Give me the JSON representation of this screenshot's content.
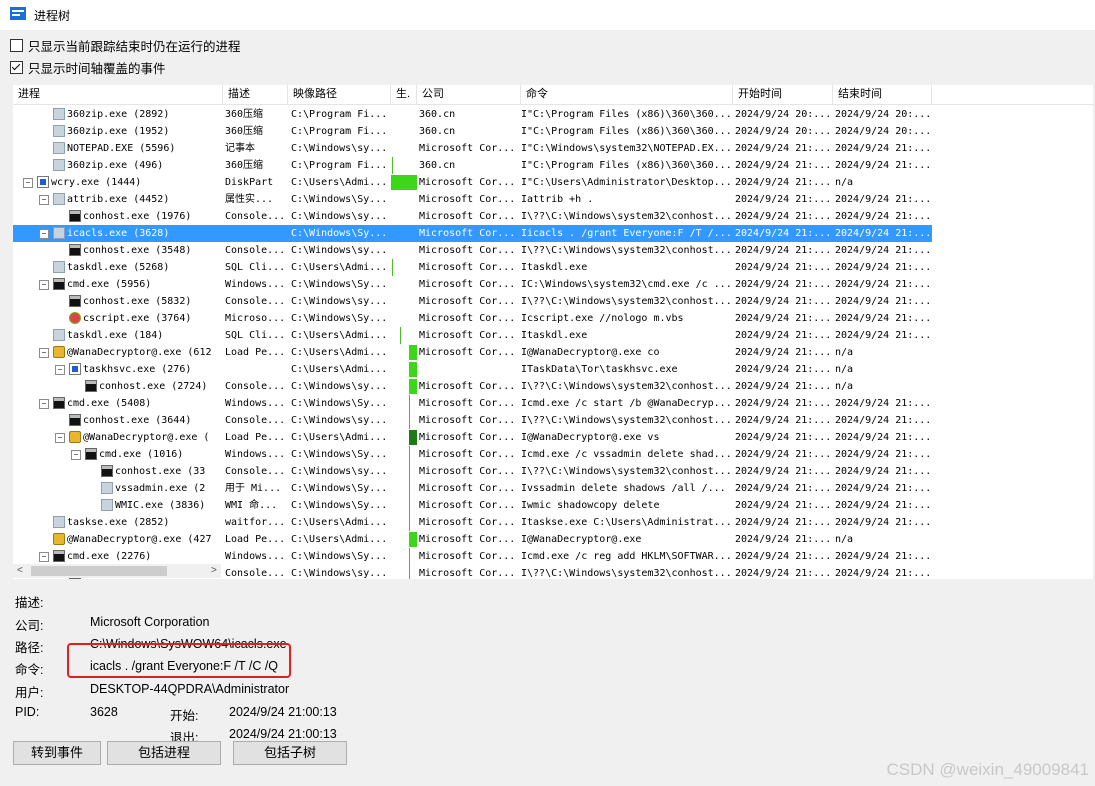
{
  "window": {
    "title": "进程树"
  },
  "options": [
    {
      "label": "只显示当前跟踪结束时仍在运行的进程",
      "checked": false
    },
    {
      "label": "只显示时间轴覆盖的事件",
      "checked": true
    }
  ],
  "columns": [
    "进程",
    "描述",
    "映像路径",
    "生.",
    "公司",
    "命令",
    "开始时间",
    "结束时间"
  ],
  "rows": [
    {
      "depth": 2,
      "toggle": "",
      "icon": "exe",
      "process": "360zip.exe (2892)",
      "desc": "360压缩",
      "path": "C:\\Program Fi...",
      "company": "360.cn",
      "cmd": "I\"C:\\Program Files (x86)\\360\\360...",
      "start": "2024/9/24 20:...",
      "end": "2024/9/24 20:...",
      "tl": "none"
    },
    {
      "depth": 2,
      "toggle": "",
      "icon": "exe",
      "process": "360zip.exe (1952)",
      "desc": "360压缩",
      "path": "C:\\Program Fi...",
      "company": "360.cn",
      "cmd": "I\"C:\\Program Files (x86)\\360\\360...",
      "start": "2024/9/24 20:...",
      "end": "2024/9/24 20:...",
      "tl": "none"
    },
    {
      "depth": 2,
      "toggle": "",
      "icon": "exe",
      "process": "NOTEPAD.EXE (5596)",
      "desc": "记事本",
      "path": "C:\\Windows\\sy...",
      "company": "Microsoft Cor...",
      "cmd": "I\"C:\\Windows\\system32\\NOTEPAD.EX...",
      "start": "2024/9/24 21:...",
      "end": "2024/9/24 21:...",
      "tl": "none"
    },
    {
      "depth": 2,
      "toggle": "",
      "icon": "exe",
      "process": "360zip.exe (496)",
      "desc": "360压缩",
      "path": "C:\\Program Fi...",
      "company": "360.cn",
      "cmd": "I\"C:\\Program Files (x86)\\360\\360...",
      "start": "2024/9/24 21:...",
      "end": "2024/9/24 21:...",
      "tl": "tick"
    },
    {
      "depth": 1,
      "toggle": "−",
      "icon": "wcry",
      "process": "wcry.exe (1444)",
      "desc": "DiskPart",
      "path": "C:\\Users\\Admi...",
      "company": "Microsoft Cor...",
      "cmd": "I\"C:\\Users\\Administrator\\Desktop...",
      "start": "2024/9/24 21:...",
      "end": "n/a",
      "tl": "bigbar"
    },
    {
      "depth": 2,
      "toggle": "−",
      "icon": "exe",
      "process": "attrib.exe (4452)",
      "desc": "属性实...",
      "path": "C:\\Windows\\Sy...",
      "company": "Microsoft Cor...",
      "cmd": "Iattrib +h .",
      "start": "2024/9/24 21:...",
      "end": "2024/9/24 21:...",
      "tl": "none"
    },
    {
      "depth": 3,
      "toggle": "",
      "icon": "cmd",
      "process": "conhost.exe (1976)",
      "desc": "Console...",
      "path": "C:\\Windows\\sy...",
      "company": "Microsoft Cor...",
      "cmd": "I\\??\\C:\\Windows\\system32\\conhost...",
      "start": "2024/9/24 21:...",
      "end": "2024/9/24 21:...",
      "tl": "none"
    },
    {
      "depth": 2,
      "toggle": "−",
      "icon": "exe",
      "process": "icacls.exe (3628)",
      "desc": "",
      "path": "C:\\Windows\\Sy...",
      "company": "Microsoft Cor...",
      "cmd": "Iicacls . /grant Everyone:F /T /...",
      "start": "2024/9/24 21:...",
      "end": "2024/9/24 21:...",
      "tl": "none",
      "selected": true
    },
    {
      "depth": 3,
      "toggle": "",
      "icon": "cmd",
      "process": "conhost.exe (3548)",
      "desc": "Console...",
      "path": "C:\\Windows\\sy...",
      "company": "Microsoft Cor...",
      "cmd": "I\\??\\C:\\Windows\\system32\\conhost...",
      "start": "2024/9/24 21:...",
      "end": "2024/9/24 21:...",
      "tl": "none"
    },
    {
      "depth": 2,
      "toggle": "",
      "icon": "exe",
      "process": "taskdl.exe (5268)",
      "desc": "SQL Cli...",
      "path": "C:\\Users\\Admi...",
      "company": "Microsoft Cor...",
      "cmd": "Itaskdl.exe",
      "start": "2024/9/24 21:...",
      "end": "2024/9/24 21:...",
      "tl": "tick"
    },
    {
      "depth": 2,
      "toggle": "−",
      "icon": "cmd",
      "process": "cmd.exe (5956)",
      "desc": "Windows...",
      "path": "C:\\Windows\\Sy...",
      "company": "Microsoft Cor...",
      "cmd": "IC:\\Windows\\system32\\cmd.exe /c ...",
      "start": "2024/9/24 21:...",
      "end": "2024/9/24 21:...",
      "tl": "none"
    },
    {
      "depth": 3,
      "toggle": "",
      "icon": "cmd",
      "process": "conhost.exe (5832)",
      "desc": "Console...",
      "path": "C:\\Windows\\sy...",
      "company": "Microsoft Cor...",
      "cmd": "I\\??\\C:\\Windows\\system32\\conhost...",
      "start": "2024/9/24 21:...",
      "end": "2024/9/24 21:...",
      "tl": "none"
    },
    {
      "depth": 3,
      "toggle": "",
      "icon": "script",
      "process": "cscript.exe (3764)",
      "desc": "Microso...",
      "path": "C:\\Windows\\Sy...",
      "company": "Microsoft Cor...",
      "cmd": "Icscript.exe //nologo m.vbs",
      "start": "2024/9/24 21:...",
      "end": "2024/9/24 21:...",
      "tl": "none"
    },
    {
      "depth": 2,
      "toggle": "",
      "icon": "exe",
      "process": "taskdl.exe (184)",
      "desc": "SQL Cli...",
      "path": "C:\\Users\\Admi...",
      "company": "Microsoft Cor...",
      "cmd": "Itaskdl.exe",
      "start": "2024/9/24 21:...",
      "end": "2024/9/24 21:...",
      "tl": "tick2"
    },
    {
      "depth": 2,
      "toggle": "−",
      "icon": "wana",
      "process": "@WanaDecryptor@.exe (612",
      "desc": "Load Pe...",
      "path": "C:\\Users\\Admi...",
      "company": "Microsoft Cor...",
      "cmd": "I@WanaDecryptor@.exe co",
      "start": "2024/9/24 21:...",
      "end": "n/a",
      "tl": "smallbar"
    },
    {
      "depth": 3,
      "toggle": "−",
      "icon": "tor",
      "process": "taskhsvc.exe (276)",
      "desc": "",
      "path": "C:\\Users\\Admi...",
      "company": "",
      "cmd": "ITaskData\\Tor\\taskhsvc.exe",
      "start": "2024/9/24 21:...",
      "end": "n/a",
      "tl": "smallbar"
    },
    {
      "depth": 4,
      "toggle": "",
      "icon": "cmd",
      "process": "conhost.exe (2724)",
      "desc": "Console...",
      "path": "C:\\Windows\\sy...",
      "company": "Microsoft Cor...",
      "cmd": "I\\??\\C:\\Windows\\system32\\conhost...",
      "start": "2024/9/24 21:...",
      "end": "n/a",
      "tl": "smallbar"
    },
    {
      "depth": 2,
      "toggle": "−",
      "icon": "cmd",
      "process": "cmd.exe (5408)",
      "desc": "Windows...",
      "path": "C:\\Windows\\Sy...",
      "company": "Microsoft Cor...",
      "cmd": "Icmd.exe /c start /b @WanaDecryp...",
      "start": "2024/9/24 21:...",
      "end": "2024/9/24 21:...",
      "tl": "tick3"
    },
    {
      "depth": 3,
      "toggle": "",
      "icon": "cmd",
      "process": "conhost.exe (3644)",
      "desc": "Console...",
      "path": "C:\\Windows\\sy...",
      "company": "Microsoft Cor...",
      "cmd": "I\\??\\C:\\Windows\\system32\\conhost...",
      "start": "2024/9/24 21:...",
      "end": "2024/9/24 21:...",
      "tl": "tick3"
    },
    {
      "depth": 3,
      "toggle": "−",
      "icon": "wana",
      "process": "@WanaDecryptor@.exe (",
      "desc": "Load Pe...",
      "path": "C:\\Users\\Admi...",
      "company": "Microsoft Cor...",
      "cmd": "I@WanaDecryptor@.exe vs",
      "start": "2024/9/24 21:...",
      "end": "2024/9/24 21:...",
      "tl": "darkbar"
    },
    {
      "depth": 4,
      "toggle": "−",
      "icon": "cmd",
      "process": "cmd.exe (1016)",
      "desc": "Windows...",
      "path": "C:\\Windows\\Sy...",
      "company": "Microsoft Cor...",
      "cmd": "Icmd.exe /c vssadmin delete shad...",
      "start": "2024/9/24 21:...",
      "end": "2024/9/24 21:...",
      "tl": "tick3"
    },
    {
      "depth": 5,
      "toggle": "",
      "icon": "cmd",
      "process": "conhost.exe (33",
      "desc": "Console...",
      "path": "C:\\Windows\\sy...",
      "company": "Microsoft Cor...",
      "cmd": "I\\??\\C:\\Windows\\system32\\conhost...",
      "start": "2024/9/24 21:...",
      "end": "2024/9/24 21:...",
      "tl": "tick3"
    },
    {
      "depth": 5,
      "toggle": "",
      "icon": "exe",
      "process": "vssadmin.exe (2",
      "desc": "用于 Mi...",
      "path": "C:\\Windows\\Sy...",
      "company": "Microsoft Cor...",
      "cmd": "Ivssadmin delete shadows /all /...",
      "start": "2024/9/24 21:...",
      "end": "2024/9/24 21:...",
      "tl": "tick3"
    },
    {
      "depth": 5,
      "toggle": "",
      "icon": "exe",
      "process": "WMIC.exe (3836)",
      "desc": "WMI 命...",
      "path": "C:\\Windows\\Sy...",
      "company": "Microsoft Cor...",
      "cmd": "Iwmic shadowcopy delete",
      "start": "2024/9/24 21:...",
      "end": "2024/9/24 21:...",
      "tl": "tick3"
    },
    {
      "depth": 2,
      "toggle": "",
      "icon": "exe",
      "process": "taskse.exe (2852)",
      "desc": "waitfor...",
      "path": "C:\\Users\\Admi...",
      "company": "Microsoft Cor...",
      "cmd": "Itaskse.exe C:\\Users\\Administrat...",
      "start": "2024/9/24 21:...",
      "end": "2024/9/24 21:...",
      "tl": "tick3"
    },
    {
      "depth": 2,
      "toggle": "",
      "icon": "wana",
      "process": "@WanaDecryptor@.exe (427",
      "desc": "Load Pe...",
      "path": "C:\\Users\\Admi...",
      "company": "Microsoft Cor...",
      "cmd": "I@WanaDecryptor@.exe",
      "start": "2024/9/24 21:...",
      "end": "n/a",
      "tl": "smallbar"
    },
    {
      "depth": 2,
      "toggle": "−",
      "icon": "cmd",
      "process": "cmd.exe (2276)",
      "desc": "Windows...",
      "path": "C:\\Windows\\Sy...",
      "company": "Microsoft Cor...",
      "cmd": "Icmd.exe /c reg add HKLM\\SOFTWAR...",
      "start": "2024/9/24 21:...",
      "end": "2024/9/24 21:...",
      "tl": "tick3"
    },
    {
      "depth": 3,
      "toggle": "",
      "icon": "cmd",
      "process": "",
      "desc": "Console...",
      "path": "C:\\Windows\\sy...",
      "company": "Microsoft Cor...",
      "cmd": "I\\??\\C:\\Windows\\system32\\conhost...",
      "start": "2024/9/24 21:...",
      "end": "2024/9/24 21:...",
      "tl": "tick3"
    }
  ],
  "details": {
    "desc_label": "描述:",
    "desc_value": "",
    "company_label": "公司:",
    "company_value": "Microsoft Corporation",
    "path_label": "路径:",
    "path_value": "C:\\Windows\\SysWOW64\\icacls.exe",
    "cmd_label": "命令:",
    "cmd_value": "icacls . /grant Everyone:F /T /C /Q",
    "user_label": "用户:",
    "user_value": "DESKTOP-44QPDRA\\Administrator",
    "pid_label": "PID:",
    "pid_value": "3628",
    "start_label": "开始:",
    "start_value": "2024/9/24 21:00:13",
    "exit_label": "退出:",
    "exit_value": "2024/9/24 21:00:13"
  },
  "buttons": {
    "goto_event": "转到事件",
    "include_process": "包括进程",
    "include_subtree": "包括子树"
  },
  "watermark": "CSDN @weixin_49009841",
  "colors": {
    "selection": "#3399ff",
    "timeline_bar": "#3ed61a",
    "timeline_dark": "#1f7a16",
    "callout": "#e0201c"
  }
}
